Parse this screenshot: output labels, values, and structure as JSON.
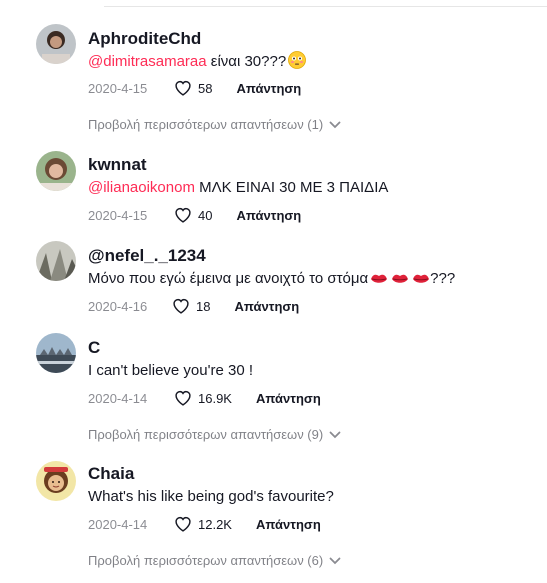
{
  "comments": [
    {
      "username": "AphroditeChd",
      "mention": "@dimitrasamaraa",
      "text": " είναι 30???",
      "emoji": "flushed-face",
      "date": "2020-4-15",
      "likes": "58",
      "reply_label": "Απάντηση",
      "more_replies": "Προβολή περισσότερων απαντήσεων (1)"
    },
    {
      "username": "kwnnat",
      "mention": "@ilianaoikonom",
      "text": " ΜΛΚ ΕΙΝΑΙ 30 ΜΕ 3 ΠΑΙΔΙΑ",
      "date": "2020-4-15",
      "likes": "40",
      "reply_label": "Απάντηση"
    },
    {
      "username": "@nefel_._1234",
      "text": "Μόνο που εγώ έμεινα με ανοιχτό το στόμα",
      "emoji": "lips",
      "text_suffix": "???",
      "date": "2020-4-16",
      "likes": "18",
      "reply_label": "Απάντηση"
    },
    {
      "username": "C",
      "text": "I can't believe you're 30 !",
      "date": "2020-4-14",
      "likes": "16.9K",
      "reply_label": "Απάντηση",
      "more_replies": "Προβολή περισσότερων απαντήσεων (9)"
    },
    {
      "username": "Chaia",
      "text": "What's his like being god's favourite?",
      "date": "2020-4-14",
      "likes": "12.2K",
      "reply_label": "Απάντηση",
      "more_replies": "Προβολή περισσότερων απαντήσεων (6)"
    }
  ],
  "colors": {
    "mention": "#fe2c55",
    "text": "#161823",
    "meta": "#8a8b91"
  },
  "icons": {
    "like": "heart-outline-icon",
    "more": "chevron-down-icon"
  }
}
